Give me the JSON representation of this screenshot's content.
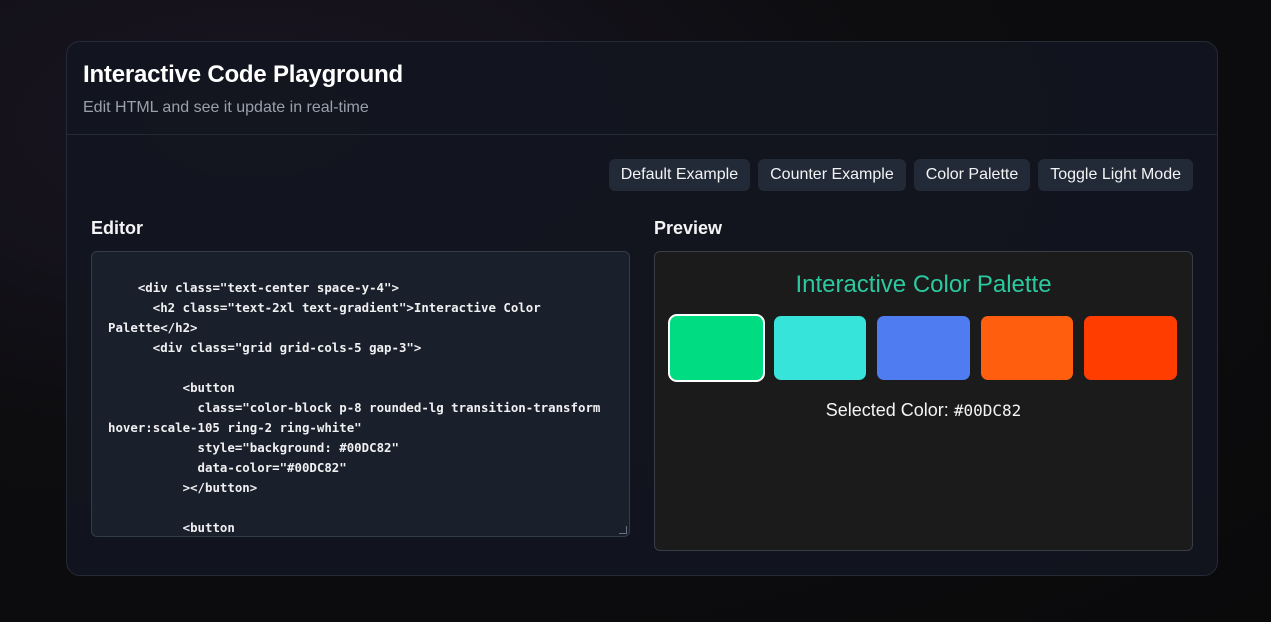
{
  "header": {
    "title": "Interactive Code Playground",
    "subtitle": "Edit HTML and see it update in real-time"
  },
  "toolbar": {
    "buttons": [
      "Default Example",
      "Counter Example",
      "Color Palette",
      "Toggle Light Mode"
    ]
  },
  "editor": {
    "label": "Editor",
    "code": "    <div class=\"text-center space-y-4\">\n      <h2 class=\"text-2xl text-gradient\">Interactive Color Palette</h2>\n      <div class=\"grid grid-cols-5 gap-3\">\n\n          <button\n            class=\"color-block p-8 rounded-lg transition-transform hover:scale-105 ring-2 ring-white\"\n            style=\"background: #00DC82\"\n            data-color=\"#00DC82\"\n          ></button>\n\n          <button"
  },
  "preview": {
    "label": "Preview",
    "title": "Interactive Color Palette",
    "swatches": [
      "#00DC82",
      "#36E4DA",
      "#4F7CF0",
      "#FF5E0E",
      "#FF3D00"
    ],
    "selected_index": 0,
    "selected_label": "Selected Color:",
    "selected_value": "#00DC82"
  }
}
